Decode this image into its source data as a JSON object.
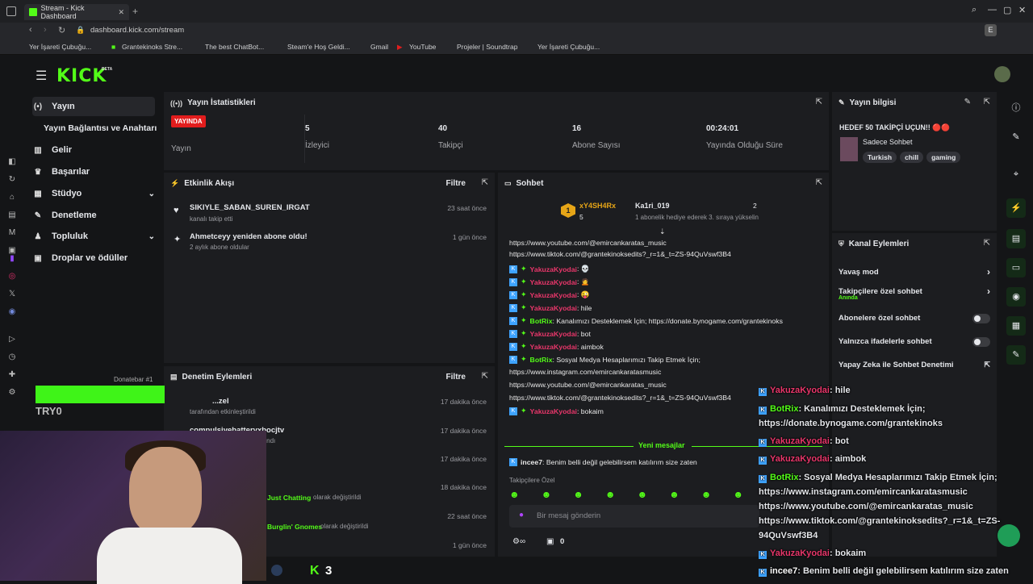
{
  "browser": {
    "tab_title": "Stream - Kick Dashboard",
    "url": "dashboard.kick.com/stream",
    "profile_initial": "E",
    "bookmarks": [
      "Yer İşareti Çubuğu...",
      "Grantekinoks Stre...",
      "The best ChatBot...",
      "Steam'e Hoş Geldi...",
      "Gmail",
      "YouTube",
      "Projeler | Soundtrap",
      "Yer İşareti Çubuğu..."
    ]
  },
  "app": {
    "logo": "KICK",
    "beta": "BETA"
  },
  "sidebar": {
    "items": [
      {
        "label": "Yayın",
        "icon": "broadcast-icon"
      },
      {
        "label": "Yayın Bağlantısı ve Anahtarı",
        "icon": ""
      },
      {
        "label": "Gelir",
        "icon": "chart-icon"
      },
      {
        "label": "Başarılar",
        "icon": "trophy-icon"
      },
      {
        "label": "Stüdyo",
        "icon": "studio-icon"
      },
      {
        "label": "Denetleme",
        "icon": "wrench-icon"
      },
      {
        "label": "Topluluk",
        "icon": "community-icon"
      },
      {
        "label": "Droplar ve ödüller",
        "icon": "gift-icon"
      }
    ]
  },
  "stats": {
    "title": "Yayın İstatistikleri",
    "live_badge": "YAYINDA",
    "live_label": "Yayın",
    "viewers": "5",
    "viewers_label": "İzleyici",
    "followers": "40",
    "followers_label": "Takipçi",
    "subs": "16",
    "subs_label": "Abone Sayısı",
    "uptime": "00:24:01",
    "uptime_label": "Yayında Olduğu Süre"
  },
  "info": {
    "title": "Yayın bilgisi",
    "stream_title": "HEDEF 50 TAKİPÇİ UÇUN!! 🔴🔴",
    "category": "Sadece Sohbet",
    "tags": [
      "Turkish",
      "chill",
      "gaming"
    ]
  },
  "activity": {
    "title": "Etkinlik Akışı",
    "filter": "Filtre",
    "events": [
      {
        "name": "SIKIYLE_SABAN_SUREN_IRGAT",
        "sub": "kanalı takip etti",
        "time": "23 saat önce"
      },
      {
        "name": "Ahmetceyy yeniden abone oldu!",
        "sub": "2 aylık abone oldular",
        "time": "1 gün önce"
      }
    ]
  },
  "modlog": {
    "title": "Denetim Eylemleri",
    "filter": "Filtre",
    "rows": [
      {
        "a": "...zel",
        "b": "tarafından etkinleştirildi",
        "time": "17 dakika önce"
      },
      {
        "a": "compulsivebatteryxbocjtv",
        "b": "yasaklandı",
        "time": "17 dakika önce"
      },
      {
        "a": "",
        "b": "",
        "time": "17 dakika önce"
      },
      {
        "a": "Just Chatting",
        "b": "olarak değiştirildi",
        "time": "18 dakika önce"
      },
      {
        "a": "Burglin' Gnomes",
        "b": "olarak değiştirildi",
        "time": "22 saat önce"
      },
      {
        "a": "",
        "b": "",
        "time": "1 gün önce"
      }
    ]
  },
  "chat": {
    "title": "Sohbet",
    "top1": {
      "rank": "1",
      "name": "xY4SH4Rx",
      "count": "5"
    },
    "top2": {
      "name": "Ka1ri_019",
      "count": "2",
      "note": "1 abonelik hediye ederek 3. sıraya yükselin"
    },
    "lines": [
      {
        "type": "plain",
        "text": "https://www.youtube.com/@emircankaratas_music"
      },
      {
        "type": "plain",
        "text": "https://www.tiktok.com/@grantekinoksedits?_r=1&_t=ZS-94QuVswf3B4"
      },
      {
        "type": "yk",
        "user": "YakuzaKyodai",
        "text": ": 💀"
      },
      {
        "type": "yk",
        "user": "YakuzaKyodai",
        "text": ": 🙍"
      },
      {
        "type": "yk",
        "user": "YakuzaKyodai",
        "text": ": 😜"
      },
      {
        "type": "yk",
        "user": "YakuzaKyodai",
        "text": ": hile"
      },
      {
        "type": "br",
        "user": "BotRix",
        "text": ": Kanalımızı Desteklemek İçin; https://donate.bynogame.com/grantekinoks"
      },
      {
        "type": "yk",
        "user": "YakuzaKyodai",
        "text": ": bot"
      },
      {
        "type": "yk",
        "user": "YakuzaKyodai",
        "text": ": aimbok"
      },
      {
        "type": "br",
        "user": "BotRix",
        "text": ": Sosyal Medya Hesaplarımızı Takip Etmek İçin;"
      },
      {
        "type": "plain",
        "text": "https://www.instagram.com/emircankaratasmusic"
      },
      {
        "type": "plain",
        "text": "https://www.youtube.com/@emircankaratas_music"
      },
      {
        "type": "plain",
        "text": "https://www.tiktok.com/@grantekinoksedits?_r=1&_t=ZS-94QuVswf3B4"
      },
      {
        "type": "yk",
        "user": "YakuzaKyodai",
        "text": ": bokaim"
      }
    ],
    "new_messages": "Yeni mesajlar",
    "last": {
      "user": "incee7",
      "text": ": Benim belli değil gelebilirsem katılırım size zaten"
    },
    "followers_only": "Takipçilere Özel",
    "placeholder": "Bir mesaj gönderin",
    "count": "0"
  },
  "actions": {
    "title": "Kanal Eylemleri",
    "slow": "Yavaş mod",
    "followers": "Takipçilere özel sohbet",
    "followers_sub": "Anında",
    "subs": "Abonelere özel sohbet",
    "emotes": "Yalnızca ifadelerle sohbet",
    "ai": "Yapay Zeka ile Sohbet Denetimi"
  },
  "overlay": {
    "donate_label": "Donatebar #1",
    "name": "TRY0",
    "followers_count": "3",
    "lines": [
      {
        "user": "YakuzaKyodai",
        "text": ": hile",
        "c": "yk"
      },
      {
        "user": "BotRix",
        "text": ": Kanalımızı Desteklemek İçin;",
        "c": "br"
      },
      {
        "user": "",
        "text": "https://donate.bynogame.com/grantekinoks",
        "c": "plain"
      },
      {
        "user": "YakuzaKyodai",
        "text": ": bot",
        "c": "yk"
      },
      {
        "user": "YakuzaKyodai",
        "text": ": aimbok",
        "c": "yk"
      },
      {
        "user": "BotRix",
        "text": ": Sosyal Medya Hesaplarımızı Takip Etmek İçin;",
        "c": "br"
      },
      {
        "user": "",
        "text": "https://www.instagram.com/emircankaratasmusic",
        "c": "plain"
      },
      {
        "user": "",
        "text": "https://www.youtube.com/@emircankaratas_music",
        "c": "plain"
      },
      {
        "user": "",
        "text": "https://www.tiktok.com/@grantekinoksedits?_r=1&_t=ZS-",
        "c": "plain"
      },
      {
        "user": "",
        "text": "94QuVswf3B4",
        "c": "plain"
      },
      {
        "user": "YakuzaKyodai",
        "text": ": bokaim",
        "c": "yk"
      },
      {
        "user": "incee7",
        "text": ": Benim belli değil gelebilirsem katılırım size zaten",
        "c": "in"
      }
    ]
  },
  "colors": {
    "accent": "#53fc18",
    "live": "#e21d1d",
    "mention": "#e8366a"
  }
}
